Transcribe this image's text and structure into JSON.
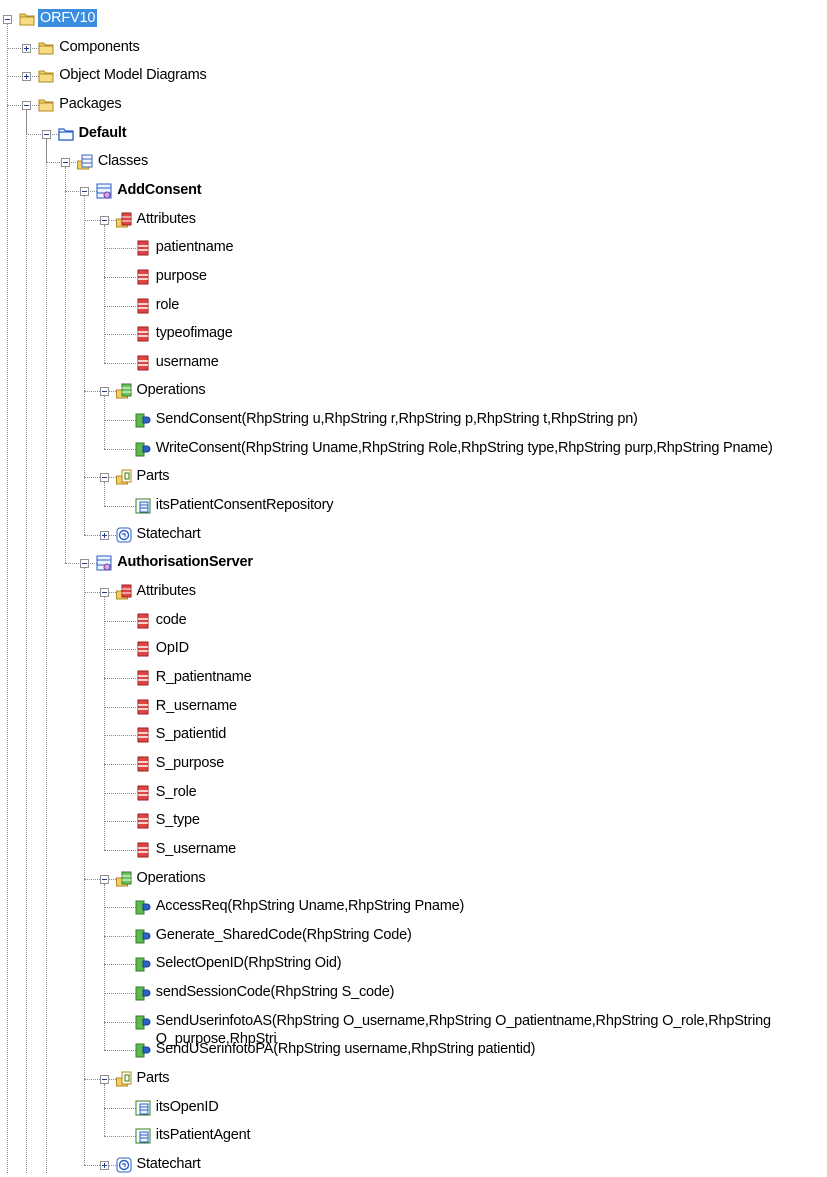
{
  "tree": [
    {
      "id": "r0",
      "depth": 0,
      "icon": "folder-icon",
      "label": "ORFV10",
      "toggle": "minus",
      "selected": true
    },
    {
      "id": "r1",
      "depth": 1,
      "icon": "folder-icon",
      "label": "Components",
      "toggle": "plus"
    },
    {
      "id": "r2",
      "depth": 1,
      "icon": "folder-icon",
      "label": "Object Model Diagrams",
      "toggle": "plus"
    },
    {
      "id": "r3",
      "depth": 1,
      "icon": "folder-icon",
      "label": "Packages",
      "toggle": "minus"
    },
    {
      "id": "r4",
      "depth": 2,
      "icon": "package-icon",
      "label": "Default",
      "toggle": "minus",
      "bold": true
    },
    {
      "id": "r5",
      "depth": 3,
      "icon": "classes-folder-icon",
      "label": "Classes",
      "toggle": "minus"
    },
    {
      "id": "r6",
      "depth": 4,
      "icon": "class-icon",
      "label": "AddConsent",
      "toggle": "minus",
      "bold": true
    },
    {
      "id": "r7",
      "depth": 5,
      "icon": "attributes-folder-icon",
      "label": "Attributes",
      "toggle": "minus"
    },
    {
      "id": "r8",
      "depth": 6,
      "icon": "attribute-icon",
      "label": "patientname"
    },
    {
      "id": "r9",
      "depth": 6,
      "icon": "attribute-icon",
      "label": "purpose"
    },
    {
      "id": "r10",
      "depth": 6,
      "icon": "attribute-icon",
      "label": "role"
    },
    {
      "id": "r11",
      "depth": 6,
      "icon": "attribute-icon",
      "label": "typeofimage"
    },
    {
      "id": "r12",
      "depth": 6,
      "icon": "attribute-icon",
      "label": "username"
    },
    {
      "id": "r13",
      "depth": 5,
      "icon": "operations-folder-icon",
      "label": "Operations",
      "toggle": "minus"
    },
    {
      "id": "r14",
      "depth": 6,
      "icon": "operation-icon",
      "label": "SendConsent(RhpString u,RhpString r,RhpString p,RhpString t,RhpString pn)"
    },
    {
      "id": "r15",
      "depth": 6,
      "icon": "operation-icon",
      "label": "WriteConsent(RhpString Uname,RhpString Role,RhpString type,RhpString purp,RhpString Pname)"
    },
    {
      "id": "r16",
      "depth": 5,
      "icon": "parts-folder-icon",
      "label": "Parts",
      "toggle": "minus"
    },
    {
      "id": "r17",
      "depth": 6,
      "icon": "part-icon",
      "label": "itsPatientConsentRepository"
    },
    {
      "id": "r18",
      "depth": 5,
      "icon": "statechart-icon",
      "label": "Statechart",
      "toggle": "plus"
    },
    {
      "id": "r19",
      "depth": 4,
      "icon": "class-icon",
      "label": "AuthorisationServer",
      "toggle": "minus",
      "bold": true
    },
    {
      "id": "r20",
      "depth": 5,
      "icon": "attributes-folder-icon",
      "label": "Attributes",
      "toggle": "minus"
    },
    {
      "id": "r21",
      "depth": 6,
      "icon": "attribute-icon",
      "label": "code"
    },
    {
      "id": "r22",
      "depth": 6,
      "icon": "attribute-icon",
      "label": "OpID"
    },
    {
      "id": "r23",
      "depth": 6,
      "icon": "attribute-icon",
      "label": "R_patientname"
    },
    {
      "id": "r24",
      "depth": 6,
      "icon": "attribute-icon",
      "label": "R_username"
    },
    {
      "id": "r25",
      "depth": 6,
      "icon": "attribute-icon",
      "label": "S_patientid"
    },
    {
      "id": "r26",
      "depth": 6,
      "icon": "attribute-icon",
      "label": "S_purpose"
    },
    {
      "id": "r27",
      "depth": 6,
      "icon": "attribute-icon",
      "label": "S_role"
    },
    {
      "id": "r28",
      "depth": 6,
      "icon": "attribute-icon",
      "label": "S_type"
    },
    {
      "id": "r29",
      "depth": 6,
      "icon": "attribute-icon",
      "label": "S_username"
    },
    {
      "id": "r30",
      "depth": 5,
      "icon": "operations-folder-icon",
      "label": "Operations",
      "toggle": "minus"
    },
    {
      "id": "r31",
      "depth": 6,
      "icon": "operation-icon",
      "label": "AccessReq(RhpString Uname,RhpString Pname)"
    },
    {
      "id": "r32",
      "depth": 6,
      "icon": "operation-icon",
      "label": "Generate_SharedCode(RhpString Code)"
    },
    {
      "id": "r33",
      "depth": 6,
      "icon": "operation-icon",
      "label": "SelectOpenID(RhpString Oid)"
    },
    {
      "id": "r34",
      "depth": 6,
      "icon": "operation-icon",
      "label": "sendSessionCode(RhpString S_code)"
    },
    {
      "id": "r35",
      "depth": 6,
      "icon": "operation-icon",
      "label": "SendUserinfotoAS(RhpString O_username,RhpString O_patientname,RhpString O_role,RhpString O_purpose,RhpStri"
    },
    {
      "id": "r36",
      "depth": 6,
      "icon": "operation-icon",
      "label": "SendUSerinfotoPA(RhpString username,RhpString patientid)"
    },
    {
      "id": "r37",
      "depth": 5,
      "icon": "parts-folder-icon",
      "label": "Parts",
      "toggle": "minus"
    },
    {
      "id": "r38",
      "depth": 6,
      "icon": "part-icon",
      "label": "itsOpenID"
    },
    {
      "id": "r39",
      "depth": 6,
      "icon": "part-icon",
      "label": "itsPatientAgent"
    },
    {
      "id": "r40",
      "depth": 5,
      "icon": "statechart-icon",
      "label": "Statechart",
      "toggle": "plus"
    }
  ]
}
